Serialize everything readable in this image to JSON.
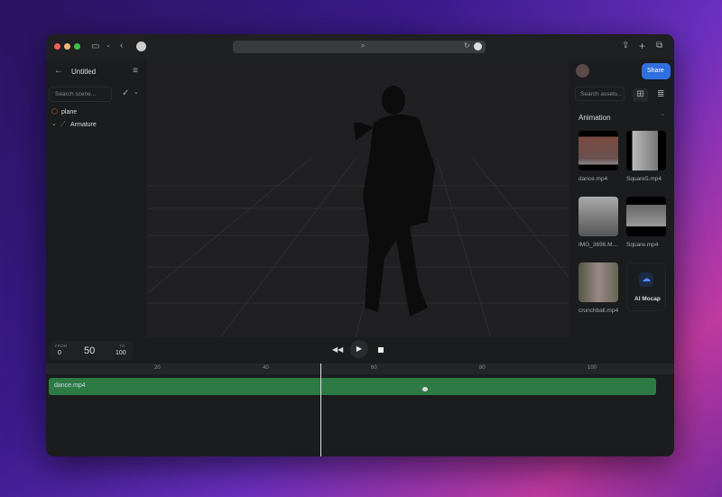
{
  "browser": {
    "url_icons": [
      "search-icon",
      "reload-icon",
      "more-icon"
    ]
  },
  "left_panel": {
    "title": "Untitled",
    "search_placeholder": "Search scene...",
    "items": [
      {
        "label": "plane",
        "icon": "cube-icon"
      },
      {
        "label": "Armature",
        "icon": "bone-icon"
      }
    ]
  },
  "right_panel": {
    "share_label": "Share",
    "search_placeholder": "Search assets...",
    "section": "Animation",
    "assets": [
      {
        "label": "dance.mp4"
      },
      {
        "label": "Square5.mp4"
      },
      {
        "label": "IMG_3696.M..."
      },
      {
        "label": "Square.mp4"
      },
      {
        "label": "crunchball.mp4"
      }
    ],
    "ai_mocap_label": "AI Mocap"
  },
  "timeline": {
    "from_label": "FROM",
    "from": "0",
    "current": "50",
    "to_label": "TO",
    "to": "100",
    "ticks": [
      "20",
      "40",
      "60",
      "80",
      "100"
    ],
    "clip_label": "dance.mp4",
    "playhead_value": 50,
    "range": [
      0,
      100
    ]
  },
  "colors": {
    "accent": "#2f6fe0",
    "clip": "#2e7a44"
  }
}
